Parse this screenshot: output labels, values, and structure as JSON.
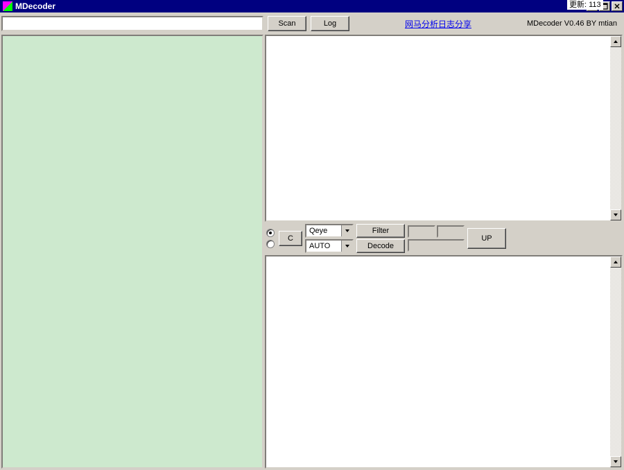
{
  "external_label": "更新: 113",
  "title": "MDecoder",
  "toolbar": {
    "scan": "Scan",
    "log": "Log",
    "link": "网马分析日志分享",
    "version": "MDecoder V0.46  BY mtian"
  },
  "url_input": {
    "value": ""
  },
  "mid": {
    "c_button": "C",
    "select1": "Qeye",
    "select2": "AUTO",
    "filter": "Filter",
    "decode": "Decode",
    "up": "UP"
  }
}
